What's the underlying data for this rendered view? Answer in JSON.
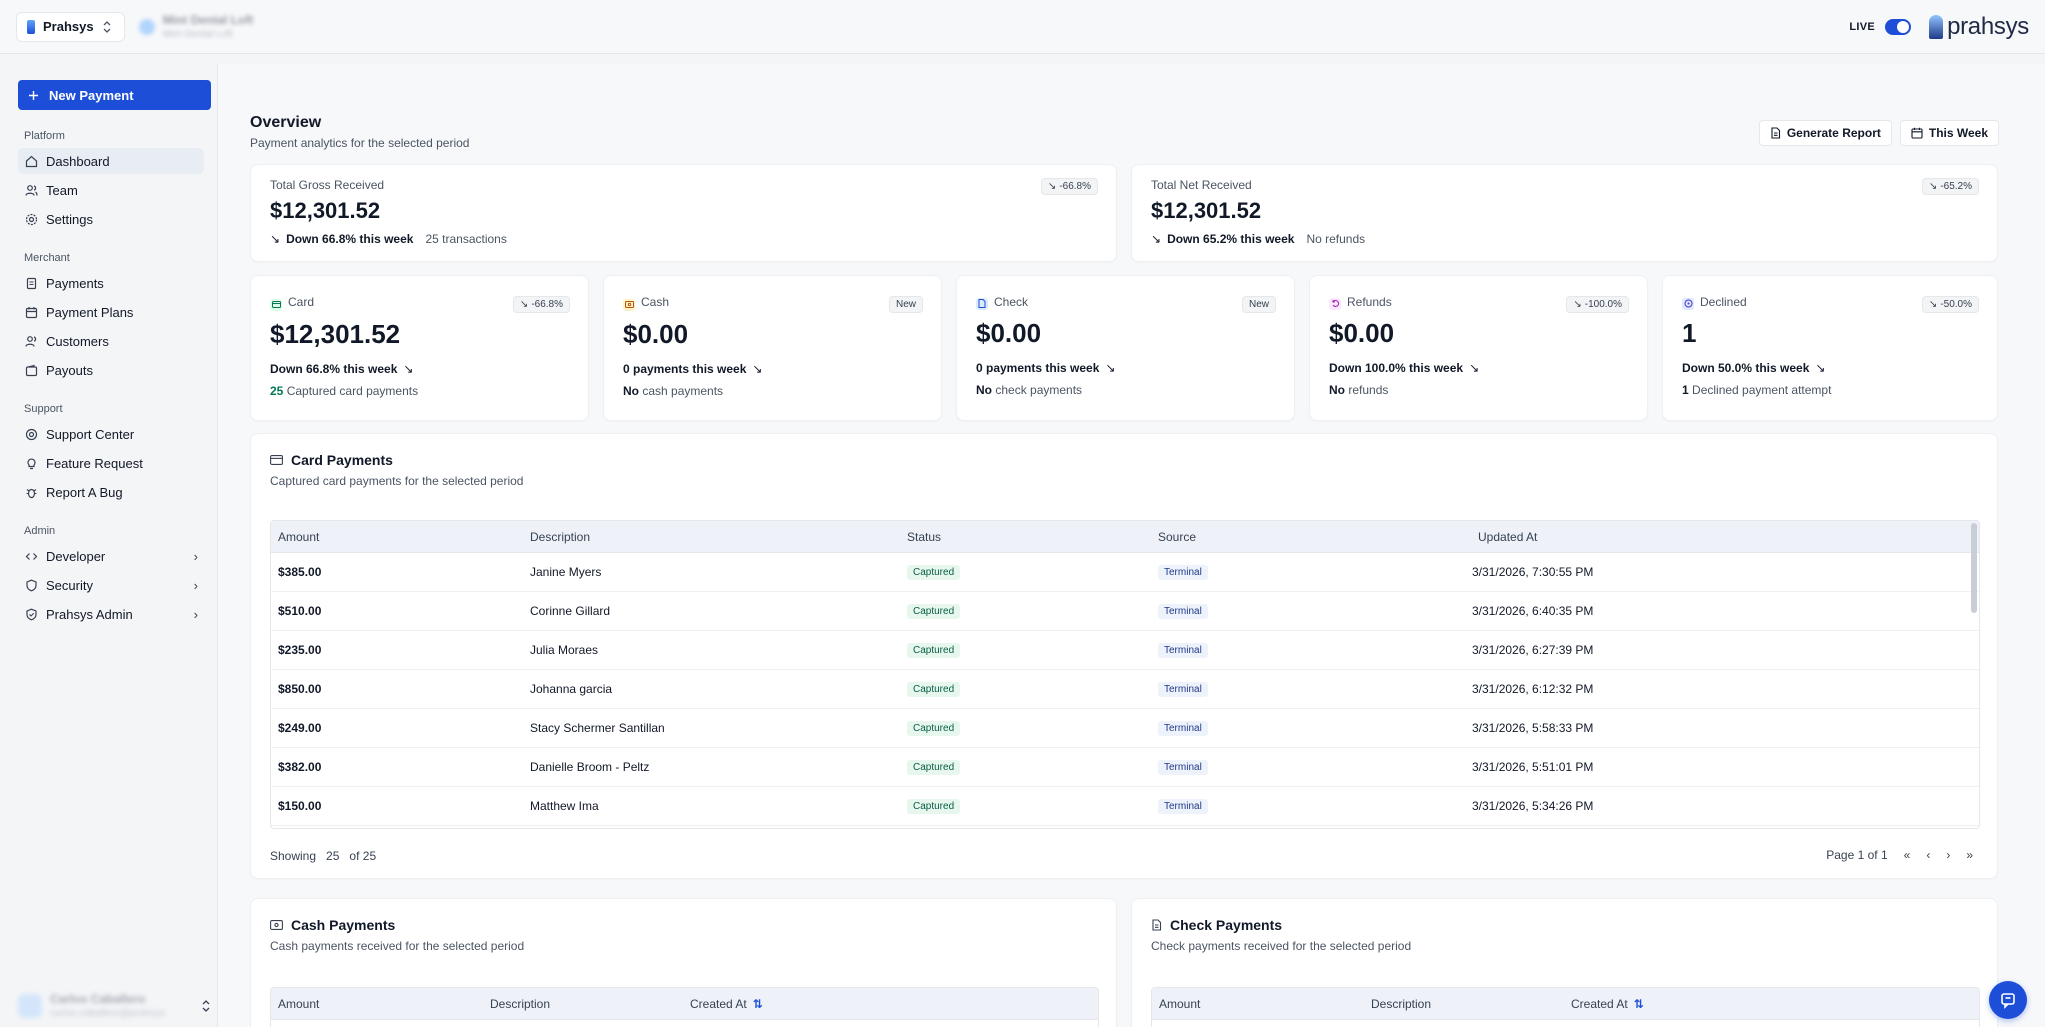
{
  "topbar": {
    "org_name": "Prahsys",
    "location_name": "Mint Dental Loft",
    "location_sub": "Mint Dental Loft",
    "live_label": "LIVE",
    "brand": "prahsys"
  },
  "sidebar": {
    "new_payment": "New Payment",
    "sections": {
      "platform": "Platform",
      "merchant": "Merchant",
      "support": "Support",
      "admin": "Admin"
    },
    "items": {
      "dashboard": "Dashboard",
      "team": "Team",
      "settings": "Settings",
      "payments": "Payments",
      "payment_plans": "Payment Plans",
      "customers": "Customers",
      "payouts": "Payouts",
      "support_center": "Support Center",
      "feature_request": "Feature Request",
      "report_bug": "Report A Bug",
      "developer": "Developer",
      "security": "Security",
      "prahsys_admin": "Prahsys Admin"
    },
    "user": {
      "name": "Carlos Caballero",
      "email": "carlos.caballero@prahsys"
    }
  },
  "overview": {
    "title": "Overview",
    "subtitle": "Payment analytics for the selected period",
    "generate_report": "Generate Report",
    "period": "This Week"
  },
  "totals": {
    "gross": {
      "label": "Total Gross Received",
      "value": "$12,301.52",
      "pill": "-66.8%",
      "trend": "Down 66.8% this week",
      "note": "25 transactions"
    },
    "net": {
      "label": "Total Net Received",
      "value": "$12,301.52",
      "pill": "-65.2%",
      "trend": "Down 65.2% this week",
      "note": "No refunds"
    }
  },
  "stats": {
    "card": {
      "label": "Card",
      "value": "$12,301.52",
      "pill": "-66.8%",
      "trend": "Down 66.8% this week",
      "count": "25",
      "note": "Captured card payments"
    },
    "cash": {
      "label": "Cash",
      "value": "$0.00",
      "pill": "New",
      "trend": "0 payments this week",
      "note_b": "No",
      "note": "cash payments"
    },
    "check": {
      "label": "Check",
      "value": "$0.00",
      "pill": "New",
      "trend": "0 payments this week",
      "note_b": "No",
      "note": "check payments"
    },
    "refunds": {
      "label": "Refunds",
      "value": "$0.00",
      "pill": "-100.0%",
      "trend": "Down 100.0% this week",
      "note_b": "No",
      "note": "refunds"
    },
    "declined": {
      "label": "Declined",
      "value": "1",
      "pill": "-50.0%",
      "trend": "Down 50.0% this week",
      "count": "1",
      "note": "Declined payment attempt"
    }
  },
  "card_payments": {
    "title": "Card Payments",
    "subtitle": "Captured card payments for the selected period",
    "columns": [
      "Amount",
      "Description",
      "Status",
      "Source",
      "Updated At"
    ],
    "rows": [
      {
        "amount": "$385.00",
        "description": "Janine Myers",
        "status": "Captured",
        "source": "Terminal",
        "updated": "3/31/2026, 7:30:55 PM"
      },
      {
        "amount": "$510.00",
        "description": "Corinne Gillard",
        "status": "Captured",
        "source": "Terminal",
        "updated": "3/31/2026, 6:40:35 PM"
      },
      {
        "amount": "$235.00",
        "description": "Julia Moraes",
        "status": "Captured",
        "source": "Terminal",
        "updated": "3/31/2026, 6:27:39 PM"
      },
      {
        "amount": "$850.00",
        "description": "Johanna garcia",
        "status": "Captured",
        "source": "Terminal",
        "updated": "3/31/2026, 6:12:32 PM"
      },
      {
        "amount": "$249.00",
        "description": "Stacy Schermer Santillan",
        "status": "Captured",
        "source": "Terminal",
        "updated": "3/31/2026, 5:58:33 PM"
      },
      {
        "amount": "$382.00",
        "description": "Danielle Broom - Peltz",
        "status": "Captured",
        "source": "Terminal",
        "updated": "3/31/2026, 5:51:01 PM"
      },
      {
        "amount": "$150.00",
        "description": "Matthew Ima",
        "status": "Captured",
        "source": "Terminal",
        "updated": "3/31/2026, 5:34:26 PM"
      }
    ],
    "showing_prefix": "Showing",
    "showing_count": "25",
    "showing_of": "of 25",
    "page_label": "Page 1 of 1"
  },
  "cash_payments": {
    "title": "Cash Payments",
    "subtitle": "Cash payments received for the selected period",
    "columns": [
      "Amount",
      "Description",
      "Created At"
    ]
  },
  "check_payments": {
    "title": "Check Payments",
    "subtitle": "Check payments received for the selected period",
    "columns": [
      "Amount",
      "Description",
      "Created At"
    ]
  },
  "colors": {
    "accent": "#1d4ed8",
    "captured_bg": "#e8f7ee",
    "terminal_bg": "#eef2fb"
  },
  "icons": [
    "plus-icon",
    "home-icon",
    "users-icon",
    "gear-icon",
    "credit-card-icon",
    "calendar-icon",
    "user-icon",
    "wallet-icon",
    "support-icon",
    "lightbulb-icon",
    "bug-icon",
    "code-icon",
    "shield-icon",
    "shield-check-icon",
    "chevron-right-icon",
    "chevrons-updown-icon",
    "file-icon",
    "trend-down-icon",
    "cash-icon",
    "check-doc-icon",
    "refund-icon",
    "declined-icon",
    "sort-icon",
    "chat-icon"
  ]
}
